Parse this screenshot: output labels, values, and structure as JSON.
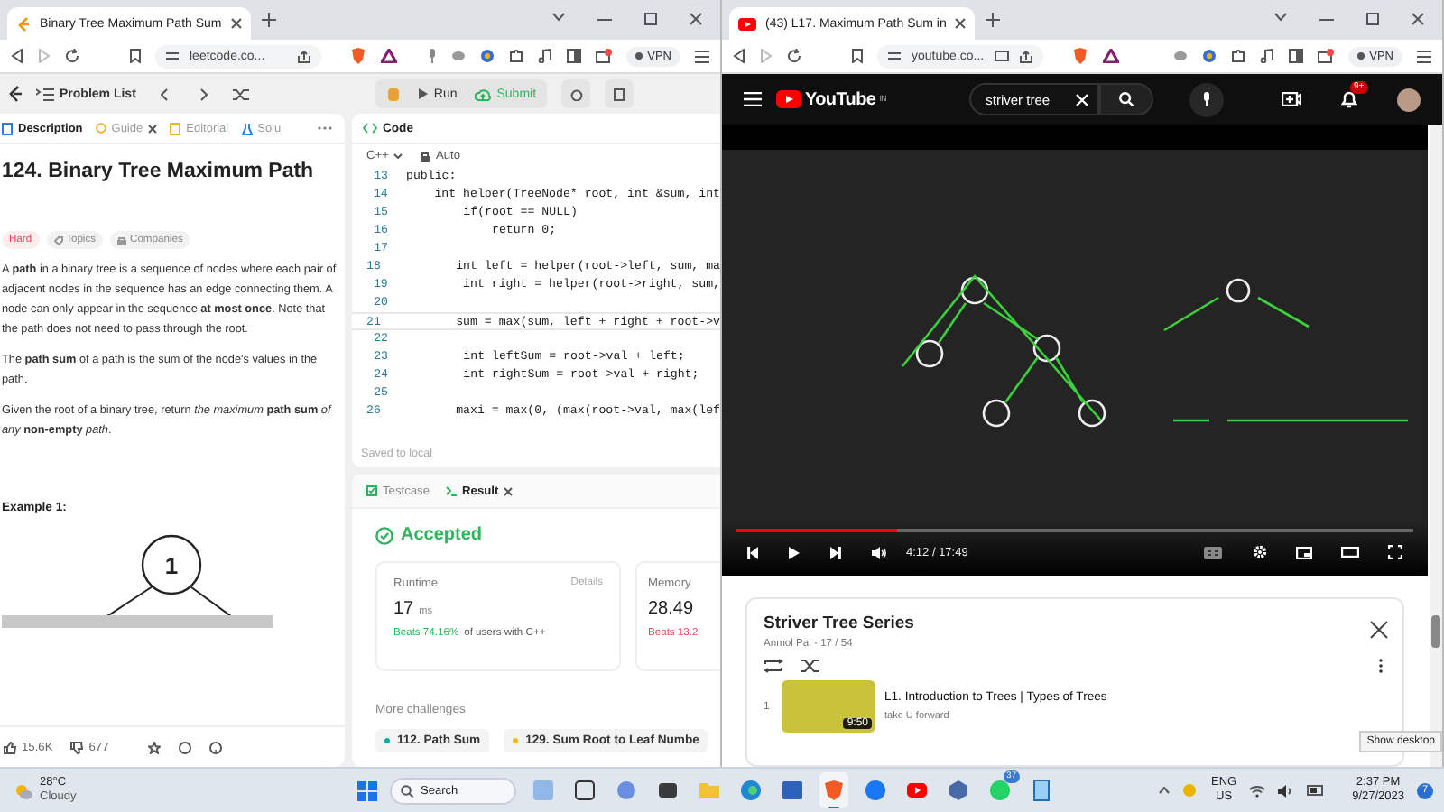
{
  "windows": [
    {
      "tab": {
        "title": "Binary Tree Maximum Path Sum"
      },
      "url": "leetcode.co...",
      "vpn": "VPN"
    },
    {
      "tab": {
        "title": "(43) L17. Maximum Path Sum in"
      },
      "url": "youtube.co...",
      "vpn": "VPN"
    }
  ],
  "leetcode": {
    "toolbar": {
      "problem_list": "Problem List",
      "run": "Run",
      "submit": "Submit"
    },
    "description_tabs": [
      {
        "label": "Description",
        "selected": true,
        "closable": false
      },
      {
        "label": "Guide",
        "selected": false,
        "closable": true
      },
      {
        "label": "Editorial",
        "selected": false,
        "closable": false
      },
      {
        "label": "Solu",
        "selected": false,
        "closable": false
      }
    ],
    "title": "124. Binary Tree Maximum Path",
    "tags": [
      {
        "kind": "difficulty",
        "label": "Hard"
      },
      {
        "kind": "topics",
        "label": "Topics"
      },
      {
        "kind": "companies",
        "label": "Companies"
      }
    ],
    "paragraphs": [
      {
        "kind": "plain",
        "text": "A **path** in a binary tree is a sequence of nodes where each pair of adjacent nodes in the sequence has an edge connecting them. A node can only appear in the sequence **at most once**. Note that the path does not need to pass through the root."
      },
      {
        "kind": "plain",
        "text": "The **path sum** of a path is the sum of the node's values in the path."
      },
      {
        "kind": "plain",
        "text": "Given the root of a binary tree, return *the maximum* **path sum** *of any* **non-empty** *path*."
      }
    ],
    "example": {
      "heading": "Example 1:",
      "root_label": "1"
    },
    "reactions": {
      "likes": "15.6K",
      "dislikes": "677"
    },
    "code": {
      "title": "Code",
      "language": "C++",
      "mode": "Auto",
      "status": "Saved to local",
      "lines": [
        {
          "number": "13",
          "text": "public:"
        },
        {
          "number": "14",
          "text": "    int helper(TreeNode* root, int &sum, int"
        },
        {
          "number": "15",
          "text": "        if(root == NULL)"
        },
        {
          "number": "16",
          "text": "            return 0;"
        },
        {
          "number": "17"
        },
        {
          "number": "18",
          "text": "        int left = helper(root->left, sum, ma"
        },
        {
          "number": "19",
          "text": "        int right = helper(root->right, sum,"
        },
        {
          "number": "20"
        },
        {
          "number": "21",
          "text": "        sum = max(sum, left + right + root->v"
        },
        {
          "number": "22"
        },
        {
          "number": "23",
          "text": "        int leftSum = root->val + left;"
        },
        {
          "number": "24",
          "text": "        int rightSum = root->val + right;"
        },
        {
          "number": "25"
        },
        {
          "number": "26",
          "text": "        maxi = max(0, (max(root->val, max(lef"
        }
      ]
    },
    "result_tabs": [
      {
        "label": "Testcase",
        "selected": false,
        "closable": false
      },
      {
        "label": "Result",
        "selected": true,
        "closable": true
      }
    ],
    "verdict": "Accepted",
    "stats": [
      {
        "label": "Runtime",
        "action": "Details",
        "value": "17",
        "unit": "ms",
        "beats": "Beats 74.16%",
        "note": "of users with C++",
        "good": true
      },
      {
        "label": "Memory",
        "value": "28.49",
        "beats": "Beats 13.2",
        "good": false
      }
    ],
    "more_challenges": {
      "heading": "More challenges",
      "items": [
        {
          "label": "112. Path Sum",
          "color": "#00af9b"
        },
        {
          "label": "129. Sum Root to Leaf Numbe",
          "color": "#ffb800"
        }
      ]
    }
  },
  "youtube": {
    "logo": "YouTube",
    "region": "IN",
    "search": {
      "value": "striver tree"
    },
    "notifications": "9+",
    "player": {
      "level": 0.236,
      "time": "4:12 / 17:49"
    },
    "playlist": {
      "title": "Striver Tree Series",
      "meta": "Anmol Pal - 17 / 54",
      "items": [
        {
          "index": "1",
          "title": "L1. Introduction to Trees | Types of Trees",
          "channel": "take U forward",
          "duration": "9:50"
        }
      ]
    }
  },
  "tooltip": "Show desktop",
  "taskbar": {
    "weather": {
      "temperature": "28°C",
      "condition": "Cloudy"
    },
    "search": {
      "placeholder": "Search"
    },
    "apps": [
      {
        "active": false
      },
      {
        "active": false
      },
      {
        "active": false
      },
      {
        "active": false
      },
      {
        "active": false
      },
      {
        "active": false
      },
      {
        "active": false
      },
      {
        "active": true
      },
      {
        "active": false
      },
      {
        "active": false
      },
      {
        "active": false
      },
      {
        "active": false,
        "badge": "37"
      },
      {
        "active": false
      }
    ],
    "tray": {
      "language": "ENG",
      "region": "US",
      "time": "2:37 PM",
      "date": "9/27/2023",
      "notifications": "7"
    }
  }
}
